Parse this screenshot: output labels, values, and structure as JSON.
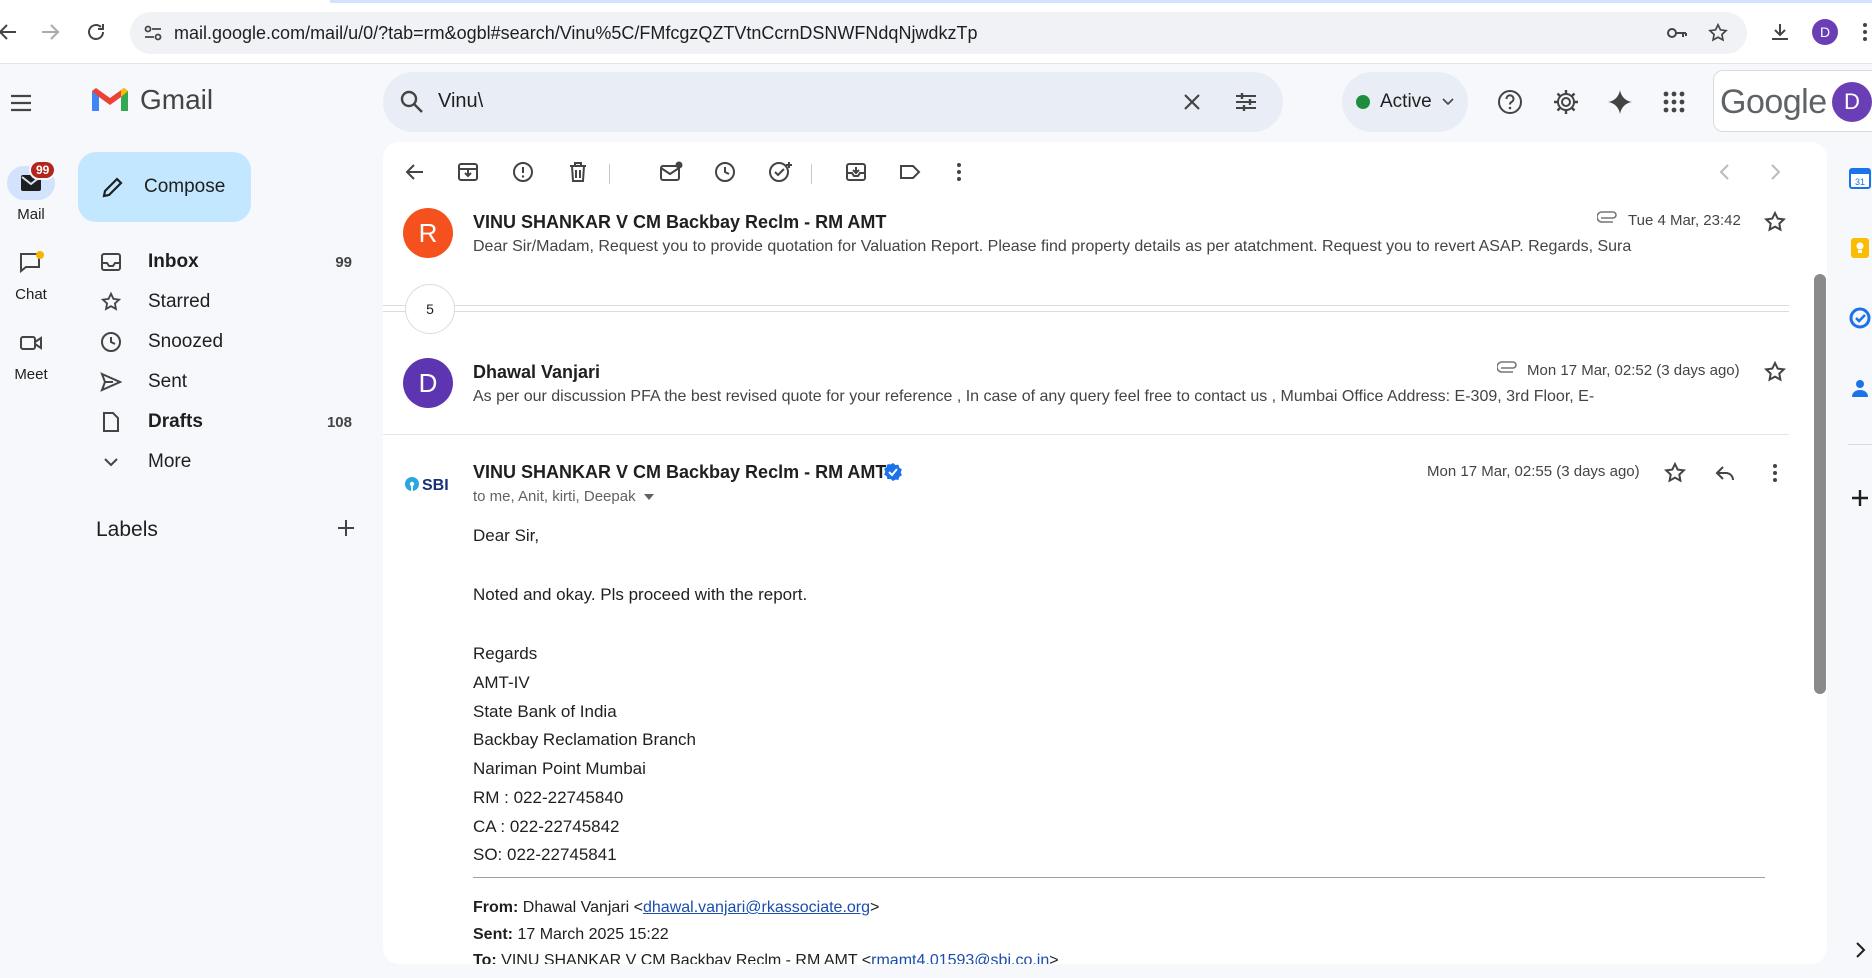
{
  "browser": {
    "url": "mail.google.com/mail/u/0/?tab=rm&ogbl#search/Vinu%5C/FMfcgzQZTVtnCcrnDSNWFNdqNjwdkzTp",
    "profile_initial": "D"
  },
  "rail": {
    "mail_label": "Mail",
    "mail_badge": "99",
    "chat_label": "Chat",
    "meet_label": "Meet"
  },
  "header": {
    "app_name": "Gmail",
    "search_query": "Vinu\\",
    "status_label": "Active",
    "google_word": "Google",
    "avatar_initial": "D"
  },
  "sidebar": {
    "compose_label": "Compose",
    "items": [
      {
        "label": "Inbox",
        "count": "99"
      },
      {
        "label": "Starred",
        "count": ""
      },
      {
        "label": "Snoozed",
        "count": ""
      },
      {
        "label": "Sent",
        "count": ""
      },
      {
        "label": "Drafts",
        "count": "108"
      },
      {
        "label": "More",
        "count": ""
      }
    ],
    "labels_heading": "Labels"
  },
  "thread": {
    "collapsed": [
      {
        "avatar_initial": "R",
        "avatar_color": "#f4511e",
        "sender": "VINU SHANKAR V CM Backbay Reclm - RM AMT",
        "snippet": "Dear Sir/Madam, Request you to provide quotation for Valuation Report. Please find property details as per atatchment. Request you to revert ASAP. Regards, Sura",
        "date": "Tue 4 Mar, 23:42"
      },
      {
        "avatar_initial": "D",
        "avatar_color": "#5e35b1",
        "sender": "Dhawal Vanjari",
        "snippet": "As per our discussion PFA the best revised quote for your reference , In case of any query feel free to contact us , Mumbai Office Address: E-309, 3rd Floor, E-",
        "date": "Mon 17 Mar, 02:52 (3 days ago)"
      }
    ],
    "hidden_count": "5",
    "open": {
      "sender_logo": "SBI",
      "sender": "VINU SHANKAR V CM Backbay Reclm - RM AMT",
      "recipients": "to me, Anit, kirti, Deepak",
      "date": "Mon 17 Mar, 02:55 (3 days ago)",
      "greeting": "Dear Sir,",
      "body": "Noted and okay. Pls proceed with the report.",
      "signature": [
        "Regards",
        "AMT-IV",
        "State Bank of India",
        "Backbay Reclamation Branch",
        "Nariman Point Mumbai",
        "RM : 022-22745840",
        "CA : 022-22745842",
        "SO: 022-22745841"
      ],
      "quoted": {
        "from_label": "From:",
        "from_name": "Dhawal Vanjari <",
        "from_email": "dhawal.vanjari@rkassociate.org",
        "from_close": ">",
        "sent_label": "Sent:",
        "sent_value": "17 March 2025 15:22",
        "to_label": "To:",
        "to_name": "VINU SHANKAR V CM Backbay Reclm - RM AMT <",
        "to_email": "rmamt4.01593@sbi.co.in",
        "to_close": ">"
      }
    }
  }
}
